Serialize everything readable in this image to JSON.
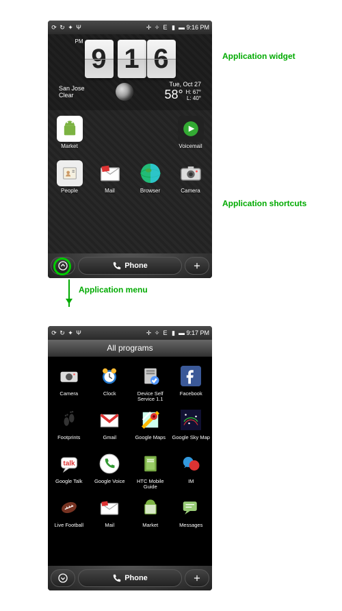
{
  "annotations": {
    "widget": "Application widget",
    "shortcuts": "Application shortcuts",
    "menu": "Application menu"
  },
  "statusbar": {
    "time_home": "9:16 PM",
    "time_programs": "9:17 PM"
  },
  "clock": {
    "h1": "9",
    "h2": "",
    "m1": "1",
    "m2": "6",
    "ampm": "PM"
  },
  "weather": {
    "city": "San Jose",
    "condition": "Clear",
    "date": "Tue, Oct 27",
    "temp": "58°",
    "high": "H: 67°",
    "low": "L: 40°"
  },
  "home_apps_row1": [
    {
      "label": "Market",
      "bg": "#fff"
    },
    {
      "label": "",
      "bg": "transparent"
    },
    {
      "label": "",
      "bg": "transparent"
    },
    {
      "label": "Voicemail",
      "bg": "#333"
    }
  ],
  "home_apps_row2": [
    {
      "label": "People",
      "bg": "#eee"
    },
    {
      "label": "Mail",
      "bg": "#eee"
    },
    {
      "label": "Browser",
      "bg": "transparent"
    },
    {
      "label": "Camera",
      "bg": "#ddd"
    }
  ],
  "bottombar": {
    "phone": "Phone"
  },
  "programs": {
    "title": "All programs",
    "apps": [
      {
        "label": "Camera"
      },
      {
        "label": "Clock"
      },
      {
        "label": "Device Self Service 1.1"
      },
      {
        "label": "Facebook"
      },
      {
        "label": "Footprints"
      },
      {
        "label": "Gmail"
      },
      {
        "label": "Google Maps"
      },
      {
        "label": "Google Sky Map"
      },
      {
        "label": "Google Talk"
      },
      {
        "label": "Google Voice"
      },
      {
        "label": "HTC Mobile Guide"
      },
      {
        "label": "IM"
      },
      {
        "label": "Live Football"
      },
      {
        "label": "Mail"
      },
      {
        "label": "Market"
      },
      {
        "label": "Messages"
      }
    ]
  }
}
